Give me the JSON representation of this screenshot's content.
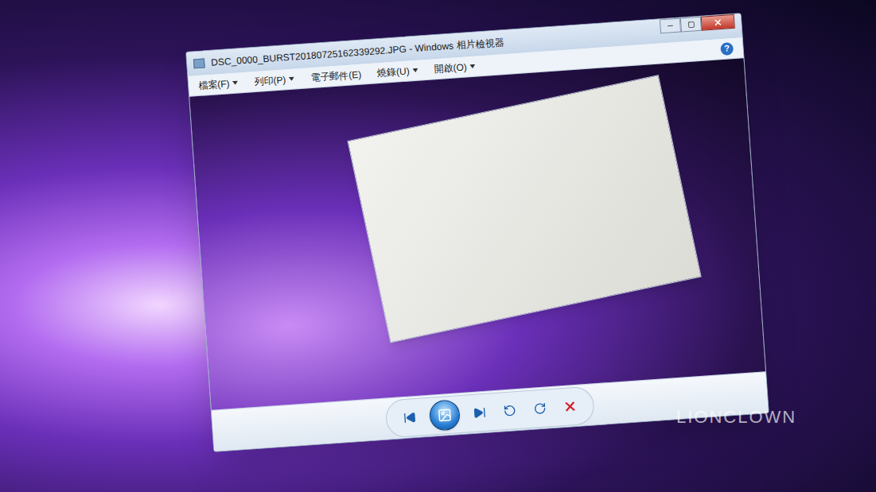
{
  "window": {
    "title": "DSC_0000_BURST20180725162339292.JPG - Windows 相片檢視器",
    "help": "?"
  },
  "menu": [
    {
      "label": "檔案(F)",
      "dropdown": true
    },
    {
      "label": "列印(P)",
      "dropdown": true
    },
    {
      "label": "電子郵件(E)",
      "dropdown": false
    },
    {
      "label": "燒錄(U)",
      "dropdown": true
    },
    {
      "label": "開啟(O)",
      "dropdown": true
    }
  ],
  "toolbar": [
    {
      "kind": "previous"
    },
    {
      "kind": "slideshow"
    },
    {
      "kind": "next"
    },
    {
      "kind": "rotate-left"
    },
    {
      "kind": "rotate-right"
    },
    {
      "kind": "delete"
    }
  ],
  "watermark": "LIONCLOWN"
}
